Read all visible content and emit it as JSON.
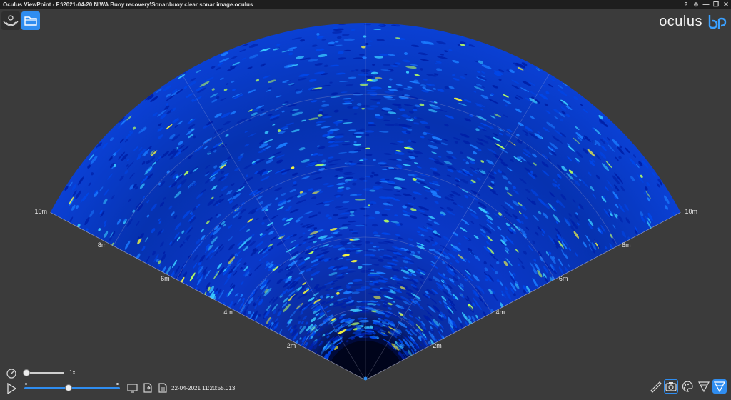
{
  "window": {
    "title": "Oculus ViewPoint - F:\\2021-04-20 NIWA Buoy recovery\\Sonar\\buoy clear sonar image.oculus",
    "controls": [
      "?",
      "⚙",
      "—",
      "❐",
      "✕"
    ]
  },
  "toolbar": {
    "sonar_button_icon": "sonar-device-icon",
    "open_button_icon": "folder-icon"
  },
  "logo": {
    "text": "oculus",
    "mark": "bp"
  },
  "sonar": {
    "range_labels": [
      "2m",
      "4m",
      "6m",
      "8m",
      "10m"
    ],
    "palette": [
      "#00063a",
      "#0020a8",
      "#0046e8",
      "#1a7bff",
      "#38c8ff",
      "#b8ff60",
      "#ffff3a"
    ]
  },
  "playback": {
    "speed_label": "1x",
    "speed_level": 0,
    "timeline_position": 0.43,
    "timestamp": "22-04-2021 11:20:55.013"
  },
  "tools": [
    {
      "name": "measure-tool-icon"
    },
    {
      "name": "camera-icon"
    },
    {
      "name": "palette-icon"
    },
    {
      "name": "gain-icon"
    },
    {
      "name": "filter-icon"
    }
  ],
  "colors": {
    "accent": "#2f8df0",
    "background": "#3b3b3b",
    "titlebar": "#1e1e1e"
  }
}
